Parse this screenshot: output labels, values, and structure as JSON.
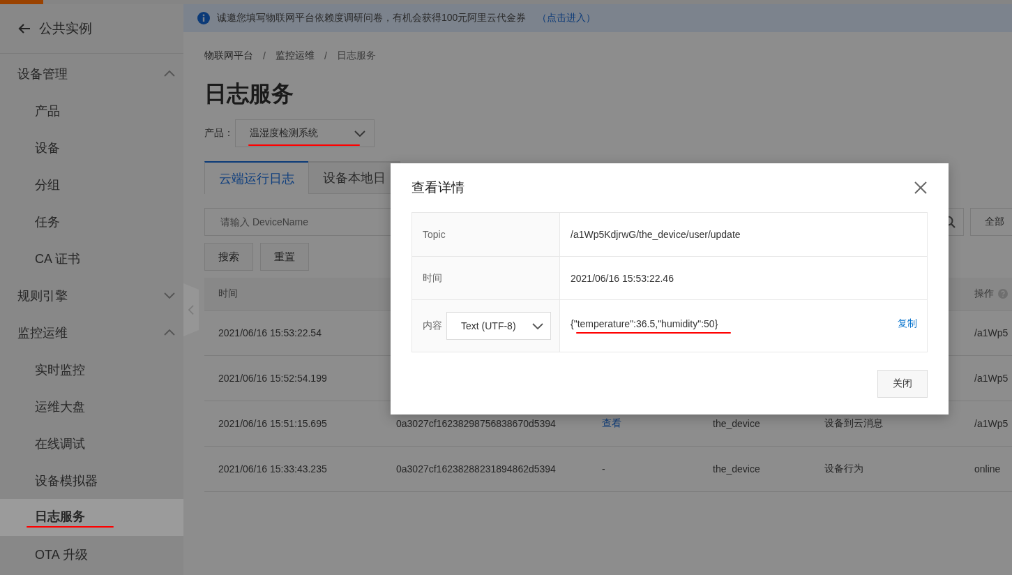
{
  "sidebar": {
    "back_label": "公共实例",
    "groups": [
      {
        "label": "设备管理",
        "expanded": true,
        "children": [
          {
            "label": "产品",
            "selected": false,
            "annotated": false
          },
          {
            "label": "设备",
            "selected": false,
            "annotated": false
          },
          {
            "label": "分组",
            "selected": false,
            "annotated": false
          },
          {
            "label": "任务",
            "selected": false,
            "annotated": false
          },
          {
            "label": "CA 证书",
            "selected": false,
            "annotated": false
          }
        ]
      },
      {
        "label": "规则引擎",
        "expanded": false
      },
      {
        "label": "监控运维",
        "expanded": true,
        "children": [
          {
            "label": "实时监控",
            "selected": false,
            "annotated": false
          },
          {
            "label": "运维大盘",
            "selected": false,
            "annotated": false
          },
          {
            "label": "在线调试",
            "selected": false,
            "annotated": false
          },
          {
            "label": "设备模拟器",
            "selected": false,
            "annotated": false
          },
          {
            "label": "日志服务",
            "selected": true,
            "annotated": true
          },
          {
            "label": "OTA 升级",
            "selected": false,
            "annotated": false
          }
        ]
      }
    ]
  },
  "banner": {
    "text": "诚邀您填写物联网平台依赖度调研问卷，有机会获得100元阿里云代金券",
    "link": "（点击进入）"
  },
  "breadcrumb": {
    "separator": "/",
    "items": [
      "物联网平台",
      "监控运维",
      "日志服务"
    ]
  },
  "page_title": "日志服务",
  "product_filter": {
    "label": "产品：",
    "value": "温湿度检测系统",
    "annotated": true
  },
  "tabs": [
    {
      "label": "云端运行日志",
      "selected": true
    },
    {
      "label": "设备本地日",
      "selected": false
    }
  ],
  "search": {
    "placeholder": "请输入 DeviceName"
  },
  "status_filter": {
    "value": "全部"
  },
  "buttons": [
    "搜索",
    "重置"
  ],
  "table": {
    "time_header": "时间",
    "operation_header": "操作",
    "operation_help": true,
    "rows": [
      {
        "time": "2021/06/16 15:53:22.54",
        "column_6": "/a1Wp5"
      },
      {
        "time": "2021/06/16 15:52:54.199",
        "column_6": "/a1Wp5"
      },
      {
        "time": "2021/06/16 15:51:15.695",
        "column_2": "0a3027cf16238298756838670d5394",
        "column_3": {
          "kind": "link",
          "text": "查看"
        },
        "column_4": "the_device",
        "column_5": "设备到云消息",
        "column_6": "/a1Wp5"
      },
      {
        "time": "2021/06/16 15:33:43.235",
        "column_2": "0a3027cf16238288231894862d5394",
        "column_3": {
          "kind": "text",
          "text": "-"
        },
        "column_4": "the_device",
        "column_5": "设备行为",
        "column_6": "online"
      }
    ]
  },
  "modal": {
    "title": "查看详情",
    "rows": [
      {
        "kind": "plain",
        "label": "Topic",
        "value": "/a1Wp5KdjrwG/the_device/user/update"
      },
      {
        "kind": "plain",
        "label": "时间",
        "value": "2021/06/16 15:53:22.46"
      },
      {
        "kind": "content",
        "label": "内容",
        "format": "Text (UTF-8)",
        "value": "{\"temperature\":36.5,\"humidity\":50}",
        "action": "复制",
        "annotated": true
      }
    ],
    "close_button": "关闭"
  }
}
